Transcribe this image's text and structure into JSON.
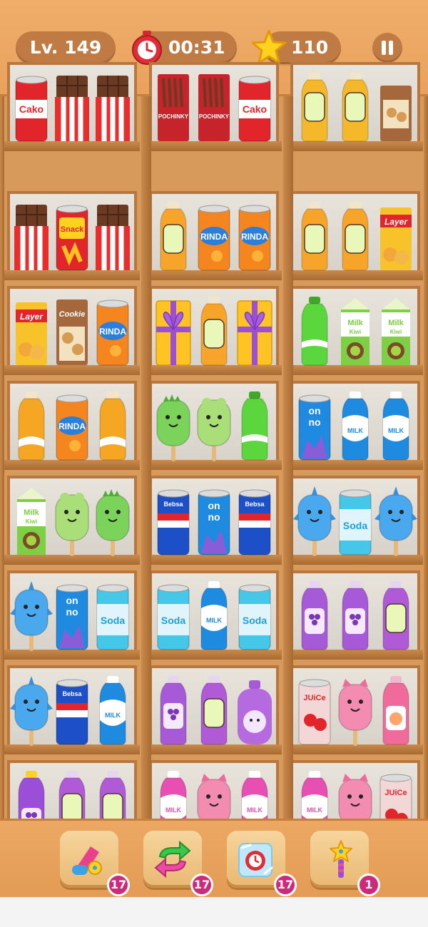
{
  "hud": {
    "level": "Lv. 149",
    "timer": "00:31",
    "stars": "110"
  },
  "boosters": [
    {
      "name": "magnet-booster-button",
      "icon": "magnet-icon",
      "count": "17"
    },
    {
      "name": "shuffle-booster-button",
      "icon": "shuffle-icon",
      "count": "17"
    },
    {
      "name": "freeze-booster-button",
      "icon": "freeze-clock-icon",
      "count": "17"
    },
    {
      "name": "magic-wand-booster-button",
      "icon": "magic-wand-icon",
      "count": "1"
    }
  ],
  "shelves": [
    [
      {
        "items": [
          "can-cako",
          "chocolate",
          "chocolate"
        ]
      },
      {
        "items": [
          "box-pochinky",
          "box-pochinky",
          "can-cako"
        ]
      },
      {
        "items": [
          "juice-bottle-yellow",
          "juice-bottle-yellow",
          "box-cookie-small"
        ]
      }
    ],
    [
      {
        "items": [
          "chocolate",
          "can-snack",
          "chocolate"
        ]
      },
      {
        "items": [
          "juice-bottle-orange",
          "can-rinda",
          "can-rinda"
        ]
      },
      {
        "items": [
          "juice-bottle-orange",
          "juice-bottle-orange",
          "box-layer"
        ]
      }
    ],
    [
      {
        "items": [
          "box-layer",
          "box-cookie",
          "can-rinda"
        ]
      },
      {
        "items": [
          "gift-box",
          "juice-bottle-orange",
          "gift-box"
        ]
      },
      {
        "items": [
          "soda-bottle-green",
          "milk-carton-kiwi",
          "milk-carton-kiwi"
        ]
      }
    ],
    [
      {
        "items": [
          "juice-bottle-tall-orange",
          "can-rinda",
          "juice-bottle-tall-orange"
        ]
      },
      {
        "items": [
          "popsicle-dino",
          "popsicle-frog",
          "soda-bottle-green"
        ]
      },
      {
        "items": [
          "can-onno",
          "milk-bottle-blue",
          "milk-bottle-blue"
        ]
      }
    ],
    [
      {
        "items": [
          "milk-carton-kiwi",
          "popsicle-frog",
          "popsicle-dino"
        ]
      },
      {
        "items": [
          "can-bebsa",
          "can-onno",
          "can-bebsa"
        ]
      },
      {
        "items": [
          "popsicle-shark",
          "can-soda",
          "popsicle-shark"
        ]
      }
    ],
    [
      {
        "items": [
          "popsicle-shark",
          "can-onno",
          "can-soda"
        ]
      },
      {
        "items": [
          "can-soda",
          "milk-bottle-blue",
          "can-soda"
        ]
      },
      {
        "items": [
          "grape-bottle",
          "grape-bottle",
          "juice-bottle-purple"
        ]
      }
    ],
    [
      {
        "items": [
          "popsicle-shark",
          "can-bebsa",
          "milk-bottle-blue"
        ]
      },
      {
        "items": [
          "grape-bottle",
          "juice-bottle-purple",
          "bunny-pouch"
        ]
      },
      {
        "items": [
          "can-juice",
          "popsicle-pig",
          "peach-bottle"
        ]
      }
    ],
    [
      {
        "items": [
          "grape-bottle-small",
          "juice-bottle-purple",
          "juice-bottle-purple"
        ]
      },
      {
        "items": [
          "milk-bottle-pink",
          "popsicle-pig",
          "milk-bottle-pink"
        ]
      },
      {
        "items": [
          "milk-bottle-pink",
          "popsicle-pig",
          "can-juice"
        ]
      }
    ]
  ],
  "labels": {
    "cako": "Cako",
    "pochinky": "POCHINKY",
    "snack": "Snack",
    "rinda": "RINDA",
    "layer": "Layer",
    "cookie": "Cookie",
    "milk": "MILK",
    "milk_kiwi": "Milk",
    "kiwi": "Kiwi",
    "onno_1": "on",
    "onno_2": "no",
    "soda": "Soda",
    "bebsa": "Bebsa",
    "juice": "JUiCe"
  },
  "colors": {
    "wood": "#b8773f",
    "panel": "#e9a862",
    "badge": "#cc2a7a"
  }
}
